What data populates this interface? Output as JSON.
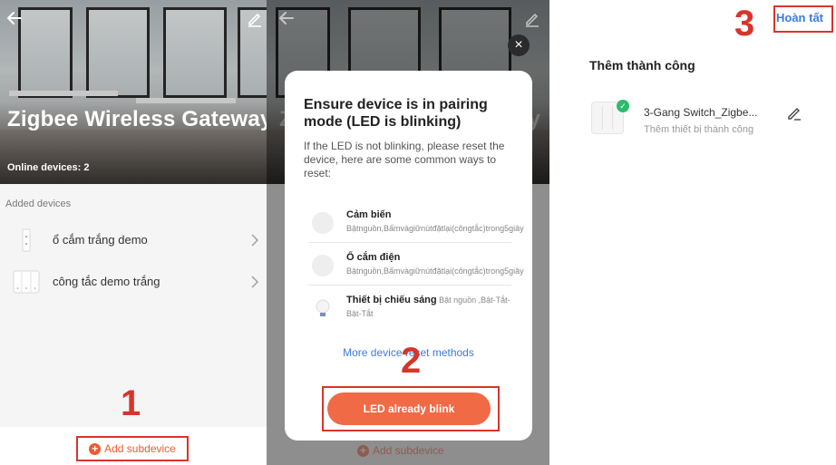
{
  "step_labels": [
    "1",
    "2",
    "3"
  ],
  "colors": {
    "accent": "#ef5a31",
    "highlight": "#d9342b",
    "link": "#3a7be0",
    "success": "#2dbb6e"
  },
  "screen1": {
    "back_icon": "back-arrow-icon",
    "edit_icon": "edit-pencil-icon",
    "gateway_title": "Zigbee Wireless Gateway",
    "online_devices": "Online devices: 2",
    "section_label": "Added devices",
    "devices": [
      {
        "name": "ổ cắm trắng demo",
        "icon": "socket-icon"
      },
      {
        "name": "công tắc demo trắng",
        "icon": "switch-icon"
      }
    ],
    "add_subdevice": "Add subdevice"
  },
  "screen2": {
    "close_icon": "close-icon",
    "title_line1": "Ensure device is in pairing",
    "title_line2": "mode (LED is blinking)",
    "description": "If the LED is not blinking, please reset the device, here are some common ways to reset:",
    "methods": [
      {
        "name": "Cảm biến",
        "text": "Bậtnguồn,Bấmvàgiữnútđặtlại(côngtắc)trong5giây",
        "icon": "sensor-icon"
      },
      {
        "name": "Ổ cắm điện",
        "text": "Bậtnguồn,Bấmvàgiữnútđặtlại(côngtắc)trong5giây",
        "icon": "plug-icon"
      },
      {
        "name": "Thiết bị chiếu sáng",
        "text": "Bật nguồn ,Bật-Tắt-Bật-Tắt",
        "icon": "bulb-icon"
      }
    ],
    "more_methods": "More device reset methods",
    "confirm_button": "LED already blink",
    "add_subdevice": "Add subdevice"
  },
  "screen3": {
    "done": "Hoàn tất",
    "success_title": "Thêm thành công",
    "device_name": "3-Gang Switch_Zigbe...",
    "device_status": "Thêm thiết bị thành công"
  }
}
